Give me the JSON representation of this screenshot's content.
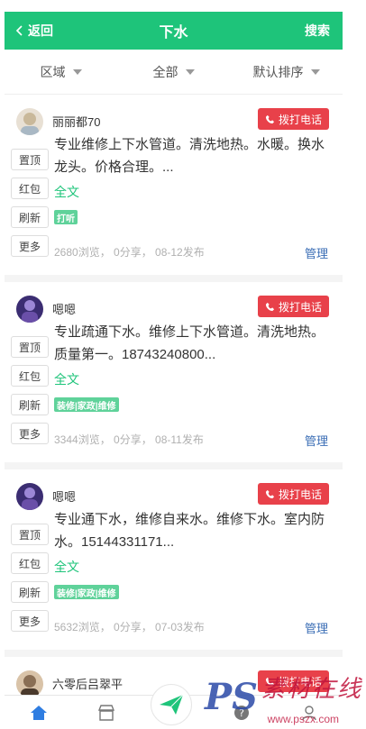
{
  "header": {
    "back_label": "返回",
    "title": "下水",
    "search_label": "搜索"
  },
  "filters": [
    {
      "label": "区域"
    },
    {
      "label": "全部"
    },
    {
      "label": "默认排序"
    }
  ],
  "side_buttons": [
    "置顶",
    "红包",
    "刷新",
    "更多"
  ],
  "call_label": "拨打电话",
  "fulltext_label": "全文",
  "manage_label": "管理",
  "posts": [
    {
      "username": "丽丽都70",
      "description": "专业维修上下水管道。清洗地热。水暖。换水龙头。价格合理。...",
      "tag": "打听",
      "stats": "2680浏览， 0分享， 08-12发布",
      "avatar_color": "#c9b89a"
    },
    {
      "username": "嗯嗯",
      "description": "专业疏通下水。维修上下水管道。清洗地热。质量第一。18743240800...",
      "tag": "装修|家政|维修",
      "stats": "3344浏览， 0分享， 08-11发布",
      "avatar_color": "#6a4fa8"
    },
    {
      "username": "嗯嗯",
      "description": "专业通下水，维修自来水。维修下水。室内防水。15144331171...",
      "tag": "装修|家政|维修",
      "stats": "5632浏览， 0分享， 07-03发布",
      "avatar_color": "#6a4fa8"
    },
    {
      "username": "六零后吕翠平",
      "avatar_color": "#8a6f55"
    }
  ],
  "watermark": {
    "brand": "PS",
    "text": "素材在线",
    "url": "www.pszx.com"
  },
  "colors": {
    "primary": "#1ec47a",
    "call": "#e8414a",
    "manage": "#3a6db5"
  }
}
